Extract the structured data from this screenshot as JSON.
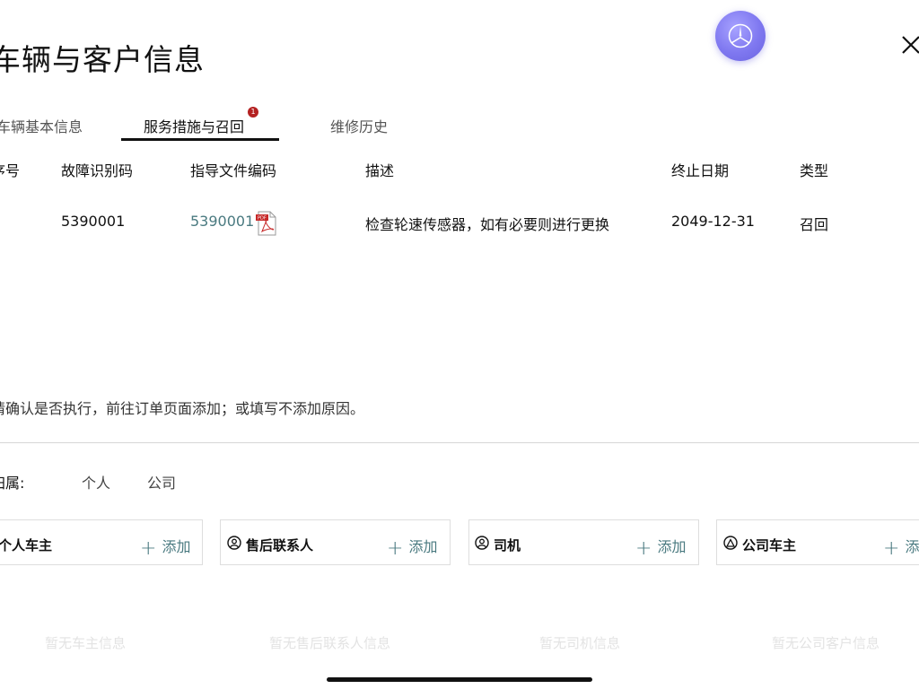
{
  "page": {
    "title": "车辆与客户信息"
  },
  "tabs": [
    {
      "label": "车辆基本信息"
    },
    {
      "label": "服务措施与召回",
      "badge": "1"
    },
    {
      "label": "维修历史"
    }
  ],
  "table": {
    "headers": [
      "序号",
      "故障识别码",
      "指导文件编码",
      "描述",
      "终止日期",
      "类型"
    ],
    "rows": [
      {
        "fault_code": "5390001",
        "doc_code": "5390001",
        "description": "检查轮速传感器，如有必要则进行更换",
        "end_date": "2049-12-31",
        "type": "召回"
      }
    ]
  },
  "note": "请确认是否执行，前往订单页面添加；或填写不添加原因。",
  "ownership": {
    "label": "归属:",
    "options": [
      "个人",
      "公司"
    ]
  },
  "cards": [
    {
      "title": "个人车主",
      "add": "添加",
      "empty": "暂无车主信息"
    },
    {
      "title": "售后联系人",
      "add": "添加",
      "empty": "暂无售后联系人信息"
    },
    {
      "title": "司机",
      "add": "添加",
      "empty": "暂无司机信息"
    },
    {
      "title": "公司车主",
      "add": "添加",
      "empty": "暂无公司客户信息"
    }
  ],
  "icons": {
    "close": "close-icon",
    "float": "star-icon",
    "pdf": "pdf-icon",
    "person": "person-icon"
  },
  "colors": {
    "accent": "#4a7a80",
    "badge": "#b42121",
    "float_button": "#7f78f0"
  }
}
